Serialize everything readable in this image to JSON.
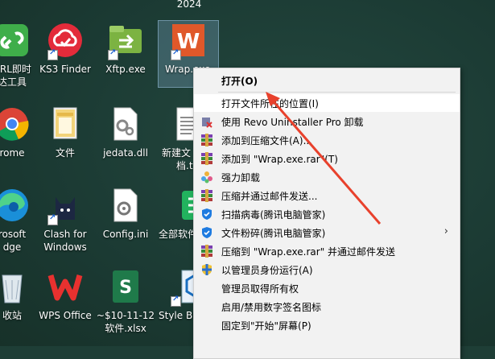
{
  "desktop": {
    "top_label": "2024",
    "icons": [
      {
        "label1": "URL即时",
        "label2": "达工具",
        "icon": "url-tool-icon"
      },
      {
        "label1": "KS3 Finder",
        "label2": "",
        "icon": "ks3-finder-icon"
      },
      {
        "label1": "Xftp.exe",
        "label2": "",
        "icon": "xftp-icon"
      },
      {
        "label1": "Wrap.exe",
        "label2": "",
        "icon": "wrap-app-icon"
      },
      {
        "label1": "rome",
        "label2": "",
        "icon": "chrome-icon"
      },
      {
        "label1": "文件",
        "label2": "",
        "icon": "folder-icon"
      },
      {
        "label1": "jedata.dll",
        "label2": "",
        "icon": "dll-file-icon"
      },
      {
        "label1": "新建文",
        "label2": "档.t",
        "icon": "text-file-icon"
      },
      {
        "label1": "rosoft",
        "label2": "dge",
        "icon": "edge-icon"
      },
      {
        "label1": "Clash for",
        "label2": "Windows",
        "icon": "clash-cat-icon"
      },
      {
        "label1": "Config.ini",
        "label2": "",
        "icon": "ini-file-icon"
      },
      {
        "label1": "全部软件",
        "label2": "",
        "icon": "software-manager-icon"
      },
      {
        "label1": "收站",
        "label2": "",
        "icon": "recycle-bin-icon"
      },
      {
        "label1": "WPS Office",
        "label2": "",
        "icon": "wps-office-icon"
      },
      {
        "label1": "~$10-11-12",
        "label2": "软件.xlsx",
        "icon": "xlsx-file-icon"
      },
      {
        "label1": "Style Bu",
        "label2": "",
        "icon": "style-builder-icon"
      }
    ]
  },
  "menu": {
    "items": [
      {
        "label": "打开(O)",
        "bold": true,
        "icon": ""
      },
      {
        "label": "打开文件所在的位置(I)",
        "icon": "",
        "highlight": true
      },
      {
        "label": "使用 Revo Uninstaller Pro 卸载",
        "icon": "revo-uninstaller-icon"
      },
      {
        "label": "添加到压缩文件(A)...",
        "icon": "winrar-icon"
      },
      {
        "label": "添加到 \"Wrap.exe.rar\"(T)",
        "icon": "winrar-icon"
      },
      {
        "label": "强力卸载",
        "icon": "force-uninstall-icon"
      },
      {
        "label": "压缩并通过邮件发送...",
        "icon": "winrar-icon"
      },
      {
        "label": "扫描病毒(腾讯电脑管家)",
        "icon": "tencent-shield-icon"
      },
      {
        "label": "文件粉碎(腾讯电脑管家)",
        "icon": "tencent-shield-icon",
        "submenu": true
      },
      {
        "label": "压缩到 \"Wrap.exe.rar\" 并通过邮件发送",
        "icon": "winrar-icon"
      },
      {
        "label": "以管理员身份运行(A)",
        "icon": "uac-shield-icon"
      },
      {
        "label": "管理员取得所有权",
        "icon": ""
      },
      {
        "label": "启用/禁用数字签名图标",
        "icon": ""
      },
      {
        "label": "固定到\"开始\"屏幕(P)",
        "icon": ""
      }
    ]
  },
  "colors": {
    "arrow": "#e8412c",
    "wrap_orange": "#e0582a"
  }
}
